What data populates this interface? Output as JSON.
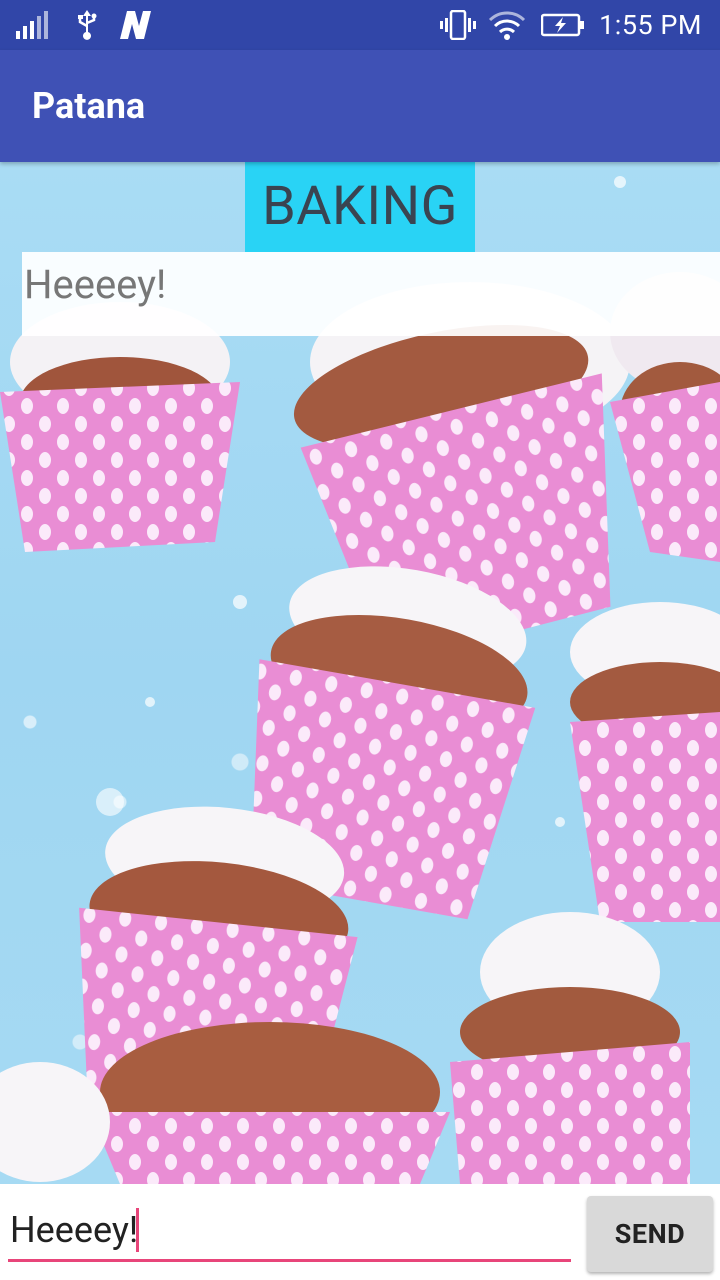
{
  "status_bar": {
    "time": "1:55 PM",
    "icons": [
      "signal-icon",
      "usb-icon",
      "notification-n-icon",
      "vibrate-icon",
      "wifi-icon",
      "battery-charging-icon"
    ]
  },
  "app_bar": {
    "title": "Patana"
  },
  "content": {
    "category": "BAKING",
    "message": "Heeeey!",
    "background": "cupcakes-image"
  },
  "composer": {
    "input_value": "Heeeey!",
    "send_label": "SEND"
  },
  "colors": {
    "primary": "#3f51b5",
    "primary_dark": "#3146a8",
    "accent": "#e8457a",
    "badge": "#29d3f5"
  }
}
